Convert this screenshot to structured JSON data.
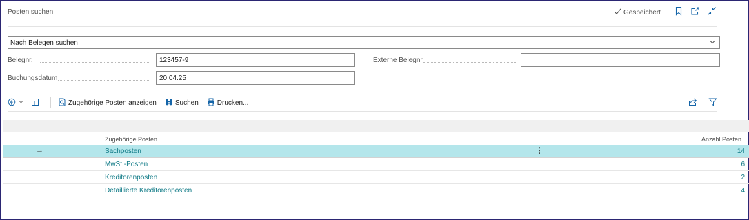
{
  "header": {
    "title": "Posten suchen",
    "saved_label": "Gespeichert",
    "icons": [
      "bookmark-icon",
      "open-new-window-icon",
      "collapse-icon"
    ]
  },
  "search": {
    "mode_selected": "Nach Belegen suchen",
    "doc_no_label": "Belegnr.",
    "doc_no_value": "123457-9",
    "external_doc_no_label": "Externe Belegnr.",
    "external_doc_no_value": "",
    "posting_date_label": "Buchungsdatum",
    "posting_date_value": "20.04.25"
  },
  "toolbar": {
    "show_related_label": "Zugehörige Posten anzeigen",
    "search_label": "Suchen",
    "print_label": "Drucken...",
    "icons": [
      "actions-icon",
      "layout-icon",
      "share-icon",
      "filter-icon"
    ]
  },
  "table": {
    "headers": [
      "Zugehörige Posten",
      "Anzahl Posten"
    ],
    "rows": [
      {
        "name": "Sachposten",
        "count": "14"
      },
      {
        "name": "MwSt.-Posten",
        "count": "6"
      },
      {
        "name": "Kreditorenposten",
        "count": "2"
      },
      {
        "name": "Detaillierte Kreditorenposten",
        "count": "4"
      }
    ],
    "selected_index": 0
  },
  "colors": {
    "accent": "#1565a8",
    "link": "#0f7a86",
    "selected_row": "#b4e6eb",
    "frame": "#2b2673"
  }
}
